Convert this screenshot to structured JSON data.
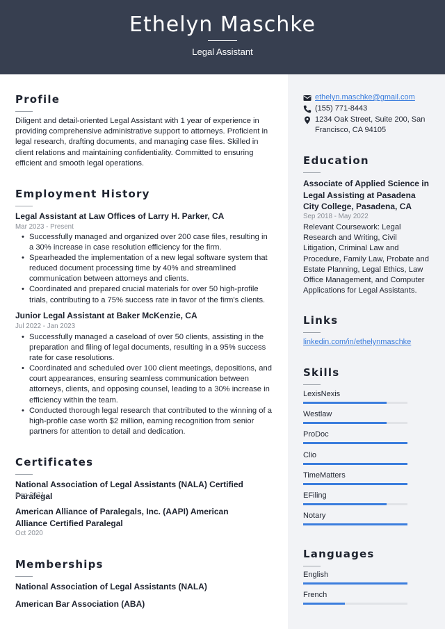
{
  "header": {
    "name": "Ethelyn Maschke",
    "title": "Legal Assistant"
  },
  "colors": {
    "header_bg": "#373f50",
    "sidebar_bg": "#f2f3f6",
    "accent": "#3b7ddd"
  },
  "profile": {
    "heading": "Profile",
    "text": "Diligent and detail-oriented Legal Assistant with 1 year of experience in providing comprehensive administrative support to attorneys. Proficient in legal research, drafting documents, and managing case files. Skilled in client relations and maintaining confidentiality. Committed to ensuring efficient and smooth legal operations."
  },
  "employment": {
    "heading": "Employment History",
    "jobs": [
      {
        "title": "Legal Assistant at Law Offices of Larry H. Parker, CA",
        "dates": "Mar 2023 - Present",
        "bullets": [
          "Successfully managed and organized over 200 case files, resulting in a 30% increase in case resolution efficiency for the firm.",
          "Spearheaded the implementation of a new legal software system that reduced document processing time by 40% and streamlined communication between attorneys and clients.",
          "Coordinated and prepared crucial materials for over 50 high-profile trials, contributing to a 75% success rate in favor of the firm's clients."
        ]
      },
      {
        "title": "Junior Legal Assistant at Baker McKenzie, CA",
        "dates": "Jul 2022 - Jan 2023",
        "bullets": [
          "Successfully managed a caseload of over 50 clients, assisting in the preparation and filing of legal documents, resulting in a 95% success rate for case resolutions.",
          "Coordinated and scheduled over 100 client meetings, depositions, and court appearances, ensuring seamless communication between attorneys, clients, and opposing counsel, leading to a 30% increase in efficiency within the team.",
          "Conducted thorough legal research that contributed to the winning of a high-profile case worth $2 million, earning recognition from senior partners for attention to detail and dedication."
        ]
      }
    ]
  },
  "certificates": {
    "heading": "Certificates",
    "items": [
      {
        "title": "National Association of Legal Assistants (NALA) Certified Paralegal",
        "date": "Dec 2021"
      },
      {
        "title": "American Alliance of Paralegals, Inc. (AAPI) American Alliance Certified Paralegal",
        "date": "Oct 2020"
      }
    ]
  },
  "memberships": {
    "heading": "Memberships",
    "items": [
      "National Association of Legal Assistants (NALA)",
      "American Bar Association (ABA)"
    ]
  },
  "contact": {
    "email": "ethelyn.maschke@gmail.com",
    "phone": "(155) 771-8443",
    "address": "1234 Oak Street, Suite 200, San Francisco, CA 94105"
  },
  "education": {
    "heading": "Education",
    "degree": "Associate of Applied Science in Legal Assisting at Pasadena City College, Pasadena, CA",
    "dates": "Sep 2018 - May 2022",
    "description": "Relevant Coursework: Legal Research and Writing, Civil Litigation, Criminal Law and Procedure, Family Law, Probate and Estate Planning, Legal Ethics, Law Office Management, and Computer Applications for Legal Assistants."
  },
  "links": {
    "heading": "Links",
    "items": [
      "linkedin.com/in/ethelynmaschke"
    ]
  },
  "skills": {
    "heading": "Skills",
    "items": [
      {
        "name": "LexisNexis",
        "level": 0.8
      },
      {
        "name": "Westlaw",
        "level": 0.8
      },
      {
        "name": "ProDoc",
        "level": 1.0
      },
      {
        "name": "Clio",
        "level": 1.0
      },
      {
        "name": "TimeMatters",
        "level": 1.0
      },
      {
        "name": "EFiling",
        "level": 0.8
      },
      {
        "name": "Notary",
        "level": 1.0
      }
    ]
  },
  "languages": {
    "heading": "Languages",
    "items": [
      {
        "name": "English",
        "level": 1.0
      },
      {
        "name": "French",
        "level": 0.4
      }
    ]
  }
}
